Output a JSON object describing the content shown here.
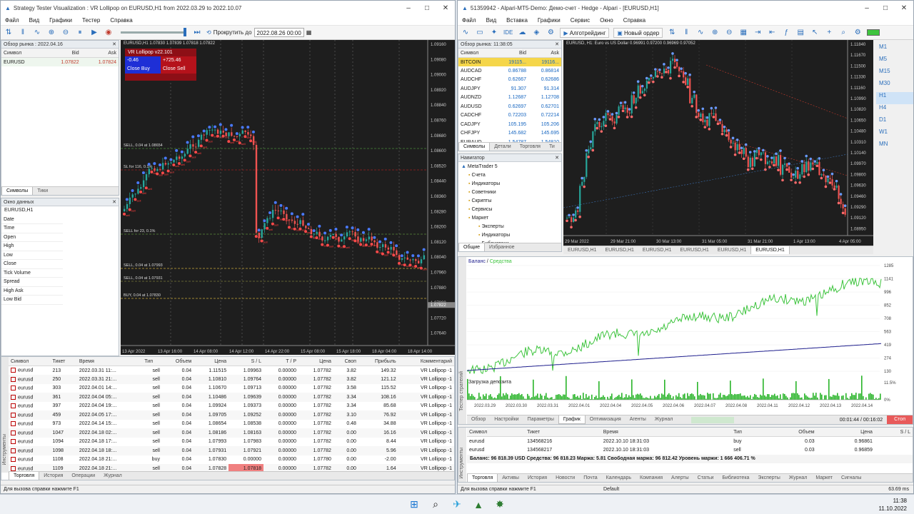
{
  "left": {
    "title": "Strategy Tester Visualization : VR Lollipop on EURUSD,H1 from 2022.03.29 to 2022.10.07",
    "menu": [
      "Файл",
      "Вид",
      "Графики",
      "Тестер",
      "Справка"
    ],
    "toolbar": {
      "scroll_label": "Прокрутить до",
      "date_value": "2022.08.26 00:00"
    },
    "market_watch": {
      "title": "Обзор рынка : 2022.04.16",
      "cols": [
        "Символ",
        "Bid",
        "Ask"
      ],
      "rows": [
        [
          "EURUSD",
          "1.07822",
          "1.07824"
        ]
      ],
      "tabs": [
        "Символы",
        "Тики"
      ]
    },
    "data_window": {
      "title": "Окно данных",
      "symbol": "EURUSD,H1",
      "fields": [
        "Date",
        "Time",
        "Open",
        "High",
        "Low",
        "Close",
        "Tick Volume",
        "Spread",
        "High Ask",
        "Low Bid"
      ]
    },
    "chart": {
      "header": "EURUSD,H1 1.07830 1.07839 1.07818 1.07822",
      "panel_title": "VR Lollipop v22.101",
      "panel_left": "-0.46",
      "panel_right": "+725.46",
      "close_buy": "Close Buy",
      "close_sell": "Close Sell",
      "prices": [
        "1.09160",
        "1.09080",
        "1.09000",
        "1.08920",
        "1.08840",
        "1.08760",
        "1.08680",
        "1.08600",
        "1.08520",
        "1.08440",
        "1.08360",
        "1.08280",
        "1.08200",
        "1.08120",
        "1.08040",
        "1.07960",
        "1.07880",
        "1.07800",
        "1.07720",
        "1.07640"
      ],
      "current_price": "1.07822",
      "dates": [
        "13 Apr 2022",
        "13 Apr 16:00",
        "14 Apr 08:00",
        "14 Apr 12:00",
        "14 Apr 22:00",
        "15 Apr 08:00",
        "15 Apr 18:00",
        "18 Apr 04:00",
        "18 Apr 14:00"
      ],
      "labels": [
        "SELL, 0.04 at 1.08654",
        "SL for 116, 0.1%",
        "SELL for 23, 0.1%",
        "SELL, 0.04 at 1.07993",
        "SELL, 0.04 at 1.07931",
        "BUY, 0.04 at 1.07830"
      ]
    },
    "trades": {
      "cols": [
        "Символ",
        "Тикет",
        "Время",
        "Тип",
        "Объем",
        "Цена",
        "S / L",
        "T / P",
        "Цена",
        "Своп",
        "Прибыль",
        "Комментарий"
      ],
      "rows": [
        [
          "eurusd",
          "213",
          "2022.03.31 11:...",
          "sell",
          "0.04",
          "1.11515",
          "1.09963",
          "0.00000",
          "1.07782",
          "3.82",
          "149.32",
          "VR Lollipop -1"
        ],
        [
          "eurusd",
          "250",
          "2022.03.31 21:...",
          "sell",
          "0.04",
          "1.10810",
          "1.09764",
          "0.00000",
          "1.07782",
          "3.82",
          "121.12",
          "VR Lollipop -1"
        ],
        [
          "eurusd",
          "303",
          "2022.04.01 14:...",
          "sell",
          "0.04",
          "1.10670",
          "1.09713",
          "0.00000",
          "1.07782",
          "3.58",
          "115.52",
          "VR Lollipop -1"
        ],
        [
          "eurusd",
          "361",
          "2022.04.04 05:...",
          "sell",
          "0.04",
          "1.10486",
          "1.09639",
          "0.00000",
          "1.07782",
          "3.34",
          "108.16",
          "VR Lollipop -1"
        ],
        [
          "eurusd",
          "397",
          "2022.04.04 19:...",
          "sell",
          "0.04",
          "1.09924",
          "1.09373",
          "0.00000",
          "1.07782",
          "3.34",
          "85.68",
          "VR Lollipop -1"
        ],
        [
          "eurusd",
          "459",
          "2022.04.05 17:...",
          "sell",
          "0.04",
          "1.09705",
          "1.09252",
          "0.00000",
          "1.07782",
          "3.10",
          "76.92",
          "VR Lollipop -1"
        ],
        [
          "eurusd",
          "973",
          "2022.04.14 15:...",
          "sell",
          "0.04",
          "1.08654",
          "1.08538",
          "0.00000",
          "1.07782",
          "0.48",
          "34.88",
          "VR Lollipop -1"
        ],
        [
          "eurusd",
          "1047",
          "2022.04.18 02:...",
          "sell",
          "0.04",
          "1.08186",
          "1.08163",
          "0.00000",
          "1.07782",
          "0.00",
          "16.16",
          "VR Lollipop -1"
        ],
        [
          "eurusd",
          "1094",
          "2022.04.18 17:...",
          "sell",
          "0.04",
          "1.07993",
          "1.07983",
          "0.00000",
          "1.07782",
          "0.00",
          "8.44",
          "VR Lollipop -1"
        ],
        [
          "eurusd",
          "1098",
          "2022.04.18 18:...",
          "sell",
          "0.04",
          "1.07931",
          "1.07921",
          "0.00000",
          "1.07782",
          "0.00",
          "5.96",
          "VR Lollipop -1"
        ],
        [
          "eurusd",
          "1108",
          "2022.04.18 21:...",
          "buy",
          "0.04",
          "1.07830",
          "0.00000",
          "0.00000",
          "1.07780",
          "0.00",
          "-2.00",
          "VR Lollipop -1"
        ],
        [
          "eurusd",
          "1109",
          "2022.04.18 21:...",
          "sell",
          "0.04",
          "1.07828",
          "1.07818",
          "0.00000",
          "1.07782",
          "0.00",
          "1.64",
          "VR Lollipop -1"
        ]
      ],
      "tabs": [
        "Торговля",
        "История",
        "Операции",
        "Журнал"
      ]
    },
    "side_label": "Инструменты",
    "status": "Для вызова справки нажмите F1"
  },
  "right": {
    "title": "51359942 - Alpari-MT5-Demo: Демо-счет - Hedge - Alpari - [EURUSD,H1]",
    "menu": [
      "Файл",
      "Вид",
      "Вставка",
      "Графики",
      "Сервис",
      "Окно",
      "Справка"
    ],
    "toolbar": {
      "ide": "IDE",
      "algo": "Алготрейдинг",
      "new_order": "Новый ордер"
    },
    "market_watch": {
      "title": "Обзор рынка: 11:38:05",
      "cols": [
        "Символ",
        "Bid",
        "Ask"
      ],
      "rows": [
        [
          "BITCOIN",
          "19115...",
          "19116..."
        ],
        [
          "AUDCAD",
          "0.86788",
          "0.86814"
        ],
        [
          "AUDCHF",
          "0.62667",
          "0.62686"
        ],
        [
          "AUDJPY",
          "91.307",
          "91.314"
        ],
        [
          "AUDNZD",
          "1.12687",
          "1.12708"
        ],
        [
          "AUDUSD",
          "0.62697",
          "0.62701"
        ],
        [
          "CADCHF",
          "0.72203",
          "0.72214"
        ],
        [
          "CADJPY",
          "105.195",
          "105.206"
        ],
        [
          "CHFJPY",
          "145.682",
          "145.695"
        ],
        [
          "EURAUD",
          "1.54787",
          "1.54810"
        ]
      ],
      "tabs": [
        "Символы",
        "Детали",
        "Торговля",
        "Ти"
      ]
    },
    "navigator": {
      "title": "Навигатор",
      "items": [
        "MetaTrader 5",
        "Счета",
        "Индикаторы",
        "Советники",
        "Скрипты",
        "Сервисы",
        "Маркет",
        "Эксперты",
        "Индикаторы",
        "Библиотеки"
      ],
      "tabs": [
        "Общие",
        "Избранное"
      ]
    },
    "chart": {
      "header": "EURUSD, H1:  Euro vs US Dollar  0.96991 0.97200 0.96969 0.97052",
      "prices": [
        "1.11670",
        "1.11500",
        "1.11330",
        "1.11160",
        "1.10990",
        "1.10820",
        "1.10650",
        "1.10480",
        "1.10310",
        "1.10140",
        "1.09970",
        "1.09800",
        "1.09630",
        "1.09460",
        "1.09290",
        "1.09120",
        "1.08950"
      ],
      "price_labels": [
        "1.11840",
        "1.11670",
        "1.11500",
        "1.11330",
        "1.11160",
        "1.10990",
        "1.10820",
        "1.10650",
        "1.10480",
        "1.10310",
        "1.10140",
        "1.09970",
        "1.09800",
        "1.09630",
        "1.09460",
        "1.09290",
        "1.09120",
        "1.08950"
      ],
      "dates": [
        "29 Mar 2022",
        "29 Mar 21:00",
        "30 Mar 13:00",
        "31 Mar 05:00",
        "31 Mar 21:00",
        "1 Apr 13:00",
        "4 Apr 05:00"
      ],
      "tabs": [
        "EURUSD,H1",
        "EURUSD,H1",
        "EURUSD,H1",
        "EURUSD,H1",
        "EURUSD,H1",
        "EURUSD,H1"
      ],
      "timeframes": [
        "M1",
        "M5",
        "M15",
        "M30",
        "H1",
        "H4",
        "D1",
        "W1",
        "MN"
      ]
    },
    "graph": {
      "legend_balance": "Баланс",
      "legend_equity": "Средства",
      "y_labels": [
        "1285",
        "1141",
        "996",
        "852",
        "708",
        "563",
        "419",
        "274",
        "130"
      ],
      "load_label": "Загрузка депозита",
      "load_pct": "11.5%",
      "load_zero": "0%",
      "dates": [
        "2022.03.29",
        "2022.03.30",
        "2022.03.31",
        "2022.04.01",
        "2022.04.04",
        "2022.04.05",
        "2022.04.06",
        "2022.04.07",
        "2022.04.08",
        "2022.04.11",
        "2022.04.12",
        "2022.04.13",
        "2022.04.14"
      ],
      "tabs": [
        "Обзор",
        "Настройки",
        "Параметры",
        "График",
        "Оптимизация",
        "Агенты",
        "Журнал"
      ],
      "time1": "00:01:44 / 00:16:02",
      "stop": "Стоп",
      "side_label": "Тестер стратегий"
    },
    "toolbox": {
      "cols": [
        "Символ",
        "Тикет",
        "Время",
        "Тип",
        "Объем",
        "Цена",
        "S / L"
      ],
      "rows": [
        [
          "eurusd",
          "134568216",
          "2022.10.10 18:31:03",
          "buy",
          "0.03",
          "0.96861",
          ""
        ],
        [
          "eurusd",
          "134568217",
          "2022.10.10 18:31:03",
          "sell",
          "0.03",
          "0.96859",
          ""
        ]
      ],
      "balance": "Баланс: 96 818.39 USD  Средства: 96 818.23  Маржа: 5.81  Свободная маржа: 96 812.42  Уровень маржи: 1 666 406.71 %",
      "tabs": [
        "Торговля",
        "Активы",
        "История",
        "Новости",
        "Почта",
        "Календарь",
        "Компания",
        "Алерты",
        "Статьи",
        "Библиотека",
        "Эксперты",
        "Журнал",
        "Маркет",
        "Сигналы"
      ],
      "side_label": "Инструменты"
    },
    "status": "Для вызова справки нажмите F1",
    "status_default": "Default",
    "ping": "63.69 ms"
  },
  "taskbar": {
    "time": "11:38",
    "date": "11.10.2022"
  },
  "colors": {
    "bull": "#26a69a",
    "bear": "#ef5350",
    "balance": "#1c1c8c",
    "equity": "#3ec43e",
    "panel_red": "#b5121b",
    "panel_blue": "#1e2fd6"
  }
}
